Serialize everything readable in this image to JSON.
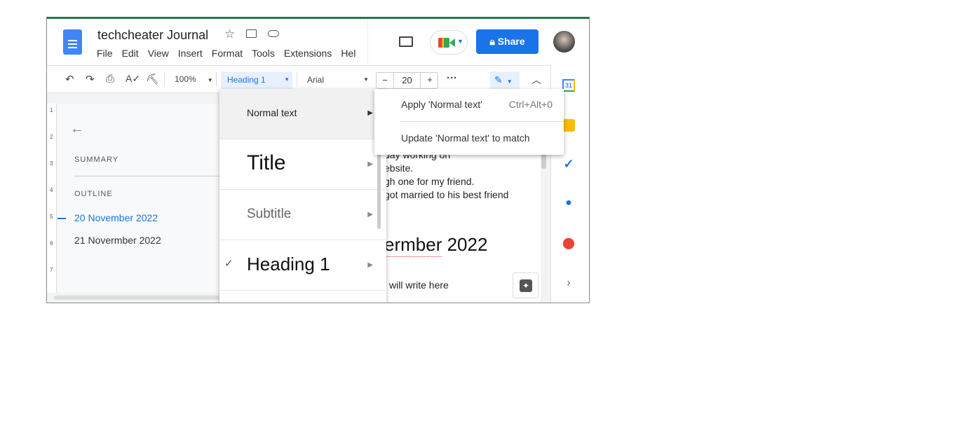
{
  "doc": {
    "title": "techcheater Journal",
    "menu": [
      "File",
      "Edit",
      "View",
      "Insert",
      "Format",
      "Tools",
      "Extensions",
      "Hel"
    ]
  },
  "header": {
    "share_label": "Share",
    "accent": "#1a73e8"
  },
  "toolbar": {
    "zoom": "100%",
    "style": "Heading 1",
    "font": "Arial",
    "font_size": "20"
  },
  "outline": {
    "summary_label": "SUMMARY",
    "outline_label": "OUTLINE",
    "items": [
      "20 November 2022",
      "21 Novermber 2022"
    ],
    "ruler": [
      "1",
      "2",
      "3",
      "4",
      "5",
      "6",
      "7"
    ]
  },
  "styles_menu": {
    "items": [
      "Normal text",
      "Title",
      "Subtitle",
      "Heading 1"
    ]
  },
  "submenu": {
    "apply": "Apply 'Normal text'",
    "shortcut": "Ctrl+Alt+0",
    "update": "Update 'Normal text' to match"
  },
  "page": {
    "lines": [
      "day working on",
      "ebsite.",
      "gh one for my friend.",
      "got married to his best friend"
    ],
    "heading": "ermber 2022",
    "body": "i will write here"
  },
  "side_panel": {
    "calendar_day": "31"
  }
}
